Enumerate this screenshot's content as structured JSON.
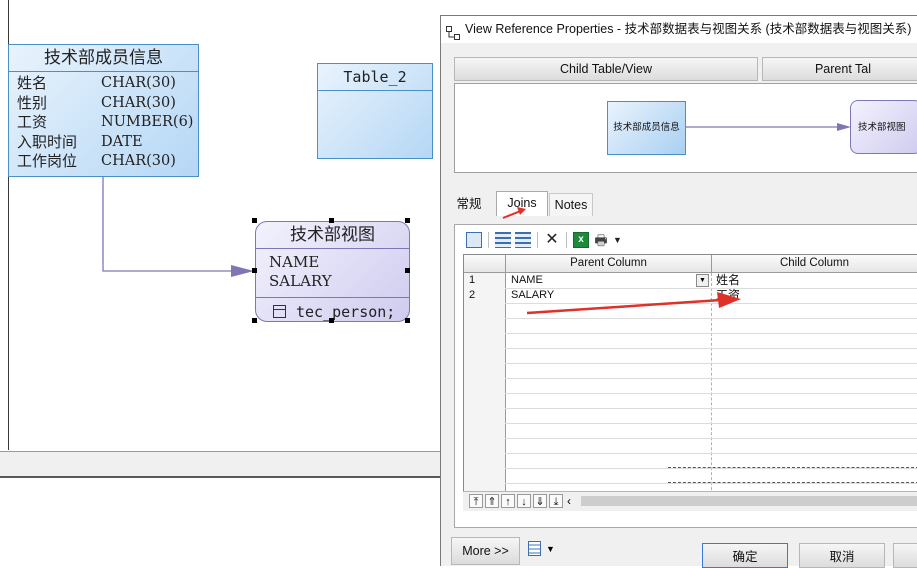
{
  "diagram": {
    "table1": {
      "title": "技术部成员信息",
      "columns": [
        {
          "name": "姓名",
          "type": "CHAR(30)"
        },
        {
          "name": "性别",
          "type": "CHAR(30)"
        },
        {
          "name": "工资",
          "type": "NUMBER(6)"
        },
        {
          "name": "入职时间",
          "type": "DATE"
        },
        {
          "name": "工作岗位",
          "type": "CHAR(30)"
        }
      ]
    },
    "table2": {
      "title": "Table_2"
    },
    "view": {
      "title": "技术部视图",
      "columns": [
        "NAME",
        "SALARY"
      ],
      "query": "tec_person;"
    }
  },
  "dialog": {
    "title": "View Reference Properties - 技术部数据表与视图关系 (技术部数据表与视图关系)",
    "header_tabs": [
      "Child Table/View",
      "Parent Tal"
    ],
    "preview": {
      "parent": "技术部成员信息",
      "child": "技术部视图"
    },
    "tabs": [
      "常规",
      "Joins",
      "Notes"
    ],
    "active_tab": "Joins",
    "grid": {
      "columns": [
        "Parent Column",
        "Child Column"
      ],
      "rows": [
        {
          "num": "1",
          "parent": "NAME",
          "child": "姓名"
        },
        {
          "num": "2",
          "parent": "SALARY",
          "child": "工资"
        }
      ]
    },
    "buttons": {
      "more": "More >>",
      "ok": "确定",
      "cancel": "取消"
    },
    "accent_arrow_color": "#e0302a"
  }
}
